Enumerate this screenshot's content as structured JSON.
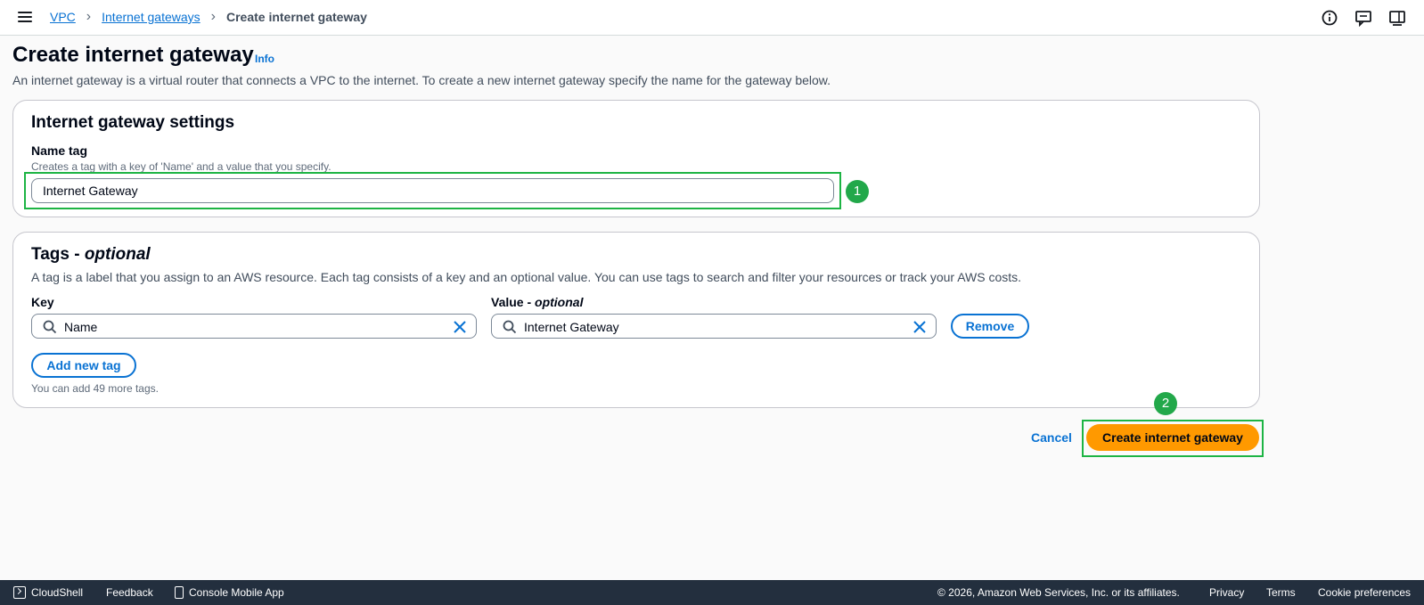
{
  "breadcrumb": {
    "items": [
      {
        "label": "VPC"
      },
      {
        "label": "Internet gateways"
      },
      {
        "label": "Create internet gateway"
      }
    ]
  },
  "header": {
    "title": "Create internet gateway",
    "info_link": "Info",
    "description": "An internet gateway is a virtual router that connects a VPC to the internet. To create a new internet gateway specify the name for the gateway below."
  },
  "settings": {
    "title": "Internet gateway settings",
    "name_tag_label": "Name tag",
    "name_tag_hint": "Creates a tag with a key of 'Name' and a value that you specify.",
    "name_tag_value": "Internet Gateway"
  },
  "tags": {
    "title_main": "Tags - ",
    "title_optional": "optional",
    "description": "A tag is a label that you assign to an AWS resource. Each tag consists of a key and an optional value. You can use tags to search and filter your resources or track your AWS costs.",
    "key_label": "Key",
    "value_label_main": "Value - ",
    "value_label_optional": "optional",
    "rows": [
      {
        "key": "Name",
        "value": "Internet Gateway",
        "remove_label": "Remove"
      }
    ],
    "add_button": "Add new tag",
    "remaining_hint": "You can add 49 more tags."
  },
  "actions": {
    "cancel": "Cancel",
    "create": "Create internet gateway"
  },
  "annotations": {
    "step1": "1",
    "step2": "2"
  },
  "footer": {
    "cloudshell": "CloudShell",
    "feedback": "Feedback",
    "mobile_app": "Console Mobile App",
    "copyright": "© 2026, Amazon Web Services, Inc. or its affiliates.",
    "privacy": "Privacy",
    "terms": "Terms",
    "cookie": "Cookie preferences"
  },
  "colors": {
    "link": "#0972d3",
    "primary_button": "#ff9900",
    "highlight": "#1db444",
    "footer_bg": "#232f3e"
  }
}
